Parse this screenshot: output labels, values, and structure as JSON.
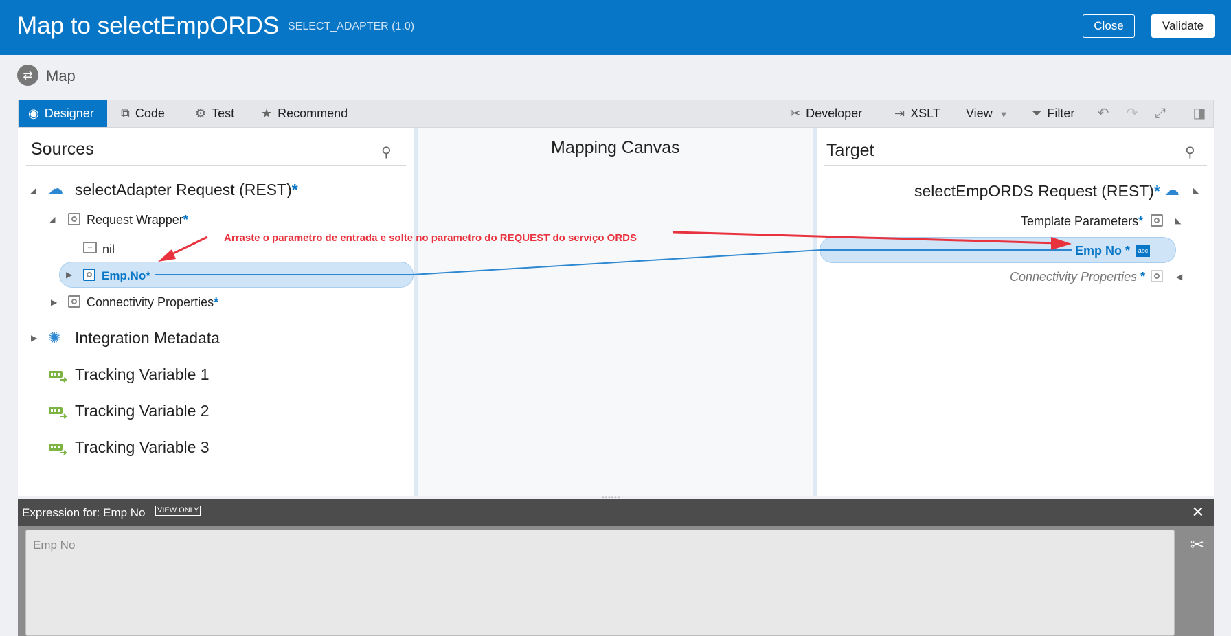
{
  "header": {
    "title": "Map to selectEmpORDS",
    "subtitle": "SELECT_ADAPTER (1.0)",
    "close_label": "Close",
    "validate_label": "Validate"
  },
  "map_label": "Map",
  "toolbar": {
    "designer": "Designer",
    "code": "Code",
    "test": "Test",
    "recommend": "Recommend",
    "developer": "Developer",
    "xslt": "XSLT",
    "view": "View",
    "filter": "Filter"
  },
  "sources": {
    "title": "Sources",
    "root": "selectAdapter Request (REST)",
    "request_wrapper": "Request Wrapper",
    "nil": "nil",
    "emp_no": "Emp.No",
    "connectivity": "Connectivity Properties",
    "integration_metadata": "Integration Metadata",
    "tracking": [
      "Tracking Variable 1",
      "Tracking Variable 2",
      "Tracking Variable 3"
    ]
  },
  "canvas": {
    "title": "Mapping Canvas",
    "annotation": "Arraste o parametro de entrada e solte no parametro do REQUEST do serviço ORDS"
  },
  "target": {
    "title": "Target",
    "root": "selectEmpORDS Request (REST)",
    "template_params": "Template Parameters",
    "emp_no": "Emp No",
    "type_badge": "abc",
    "connectivity": "Connectivity Properties"
  },
  "expression": {
    "label": "Expression for: Emp No",
    "badge": "VIEW ONLY",
    "value": "Emp No"
  },
  "colors": {
    "header_bg": "#0876c7",
    "accent": "#0876c7",
    "annotation": "#e8333f",
    "mapping_line": "#2d88d1"
  },
  "icons": {
    "designer": "designer-icon",
    "code": "code-icon",
    "test": "gear-icon",
    "recommend": "star-icon",
    "developer": "wrench-icon",
    "xslt": "xslt-icon",
    "filter": "filter-icon",
    "search": "search-icon",
    "close": "close-icon"
  }
}
